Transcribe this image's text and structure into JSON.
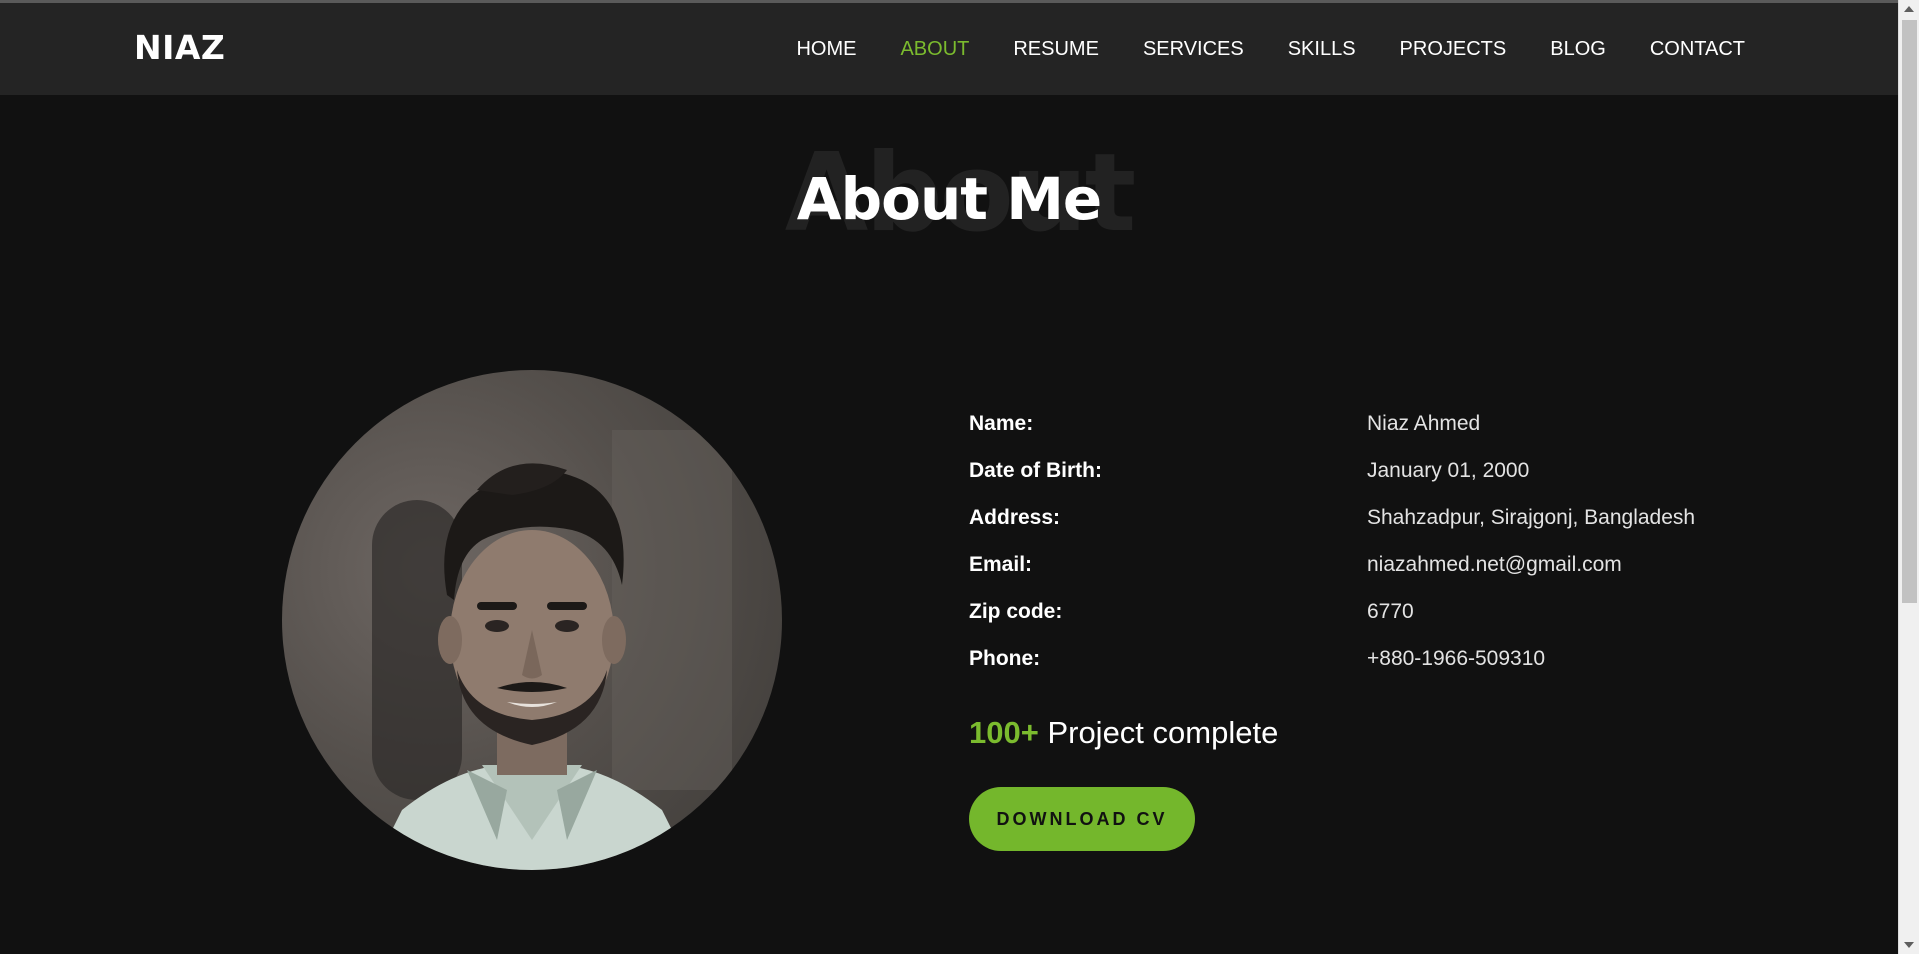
{
  "brand": "NIAZ",
  "nav": {
    "items": [
      {
        "label": "HOME"
      },
      {
        "label": "ABOUT",
        "active": true
      },
      {
        "label": "RESUME"
      },
      {
        "label": "SERVICES"
      },
      {
        "label": "SKILLS"
      },
      {
        "label": "PROJECTS"
      },
      {
        "label": "BLOG"
      },
      {
        "label": "CONTACT"
      }
    ]
  },
  "section": {
    "bg_word": "About",
    "title": "About Me"
  },
  "profile": {
    "rows": [
      {
        "label": "Name:",
        "value": "Niaz Ahmed"
      },
      {
        "label": "Date of Birth:",
        "value": "January 01, 2000"
      },
      {
        "label": "Address:",
        "value": "Shahzadpur, Sirajgonj, Bangladesh"
      },
      {
        "label": "Email:",
        "value": "niazahmed.net@gmail.com"
      },
      {
        "label": "Zip code:",
        "value": "6770"
      },
      {
        "label": "Phone:",
        "value": "+880-1966-509310"
      }
    ],
    "projects_count": "100+",
    "projects_text": " Project complete",
    "cv_button": "DOWNLOAD CV"
  },
  "colors": {
    "accent": "#74b72c",
    "background": "#111111",
    "navbar": "#242424"
  }
}
